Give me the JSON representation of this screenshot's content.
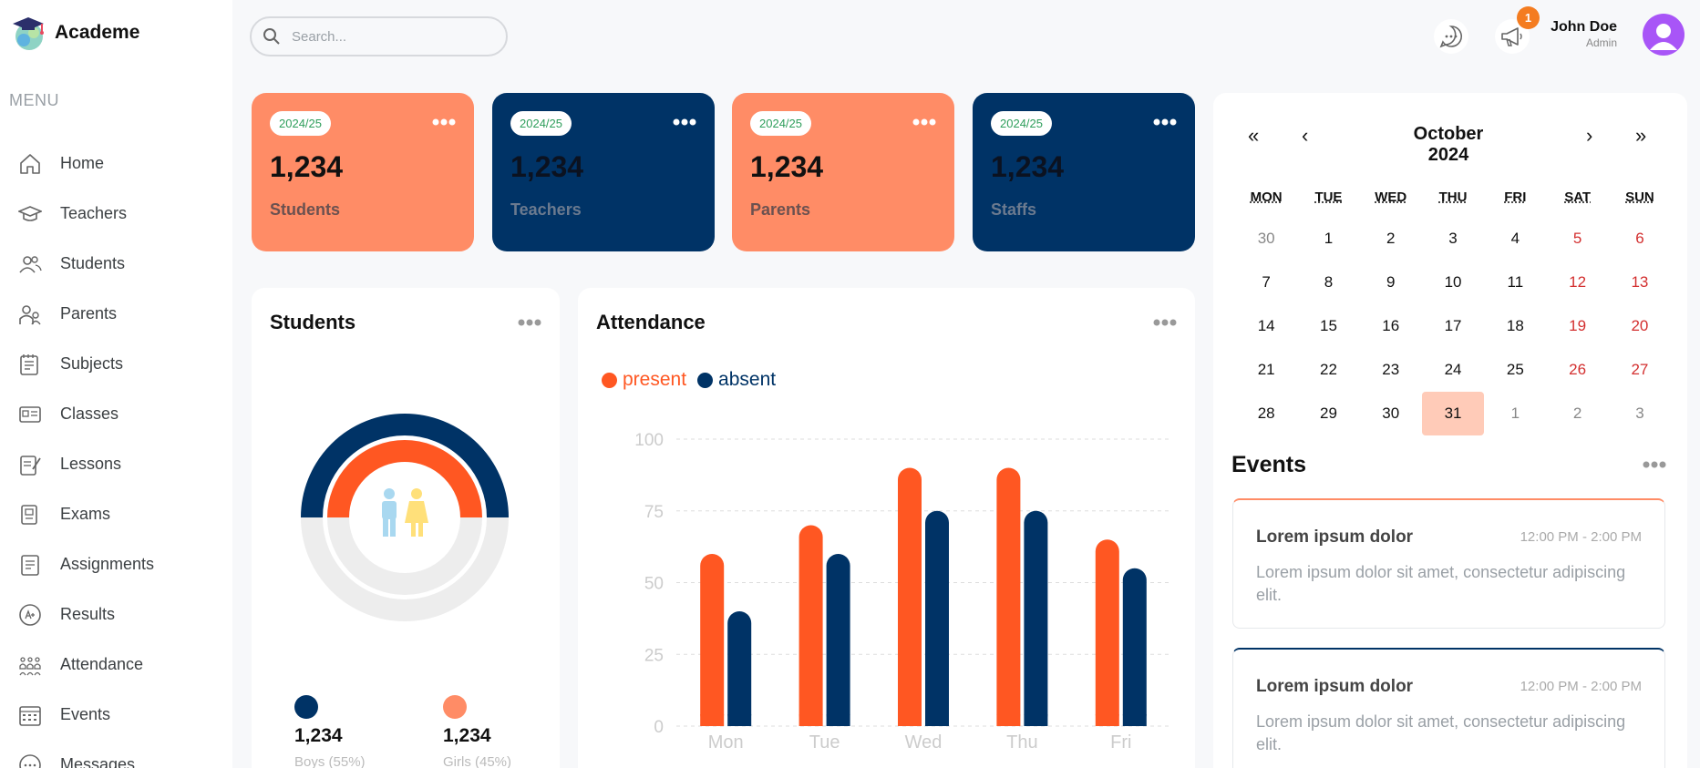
{
  "brand": {
    "name": "Academe"
  },
  "sidebar": {
    "menu_title": "MENU",
    "items": [
      {
        "label": "Home",
        "icon": "home-icon"
      },
      {
        "label": "Teachers",
        "icon": "teacher-icon"
      },
      {
        "label": "Students",
        "icon": "students-icon"
      },
      {
        "label": "Parents",
        "icon": "parents-icon"
      },
      {
        "label": "Subjects",
        "icon": "subjects-icon"
      },
      {
        "label": "Classes",
        "icon": "classes-icon"
      },
      {
        "label": "Lessons",
        "icon": "lessons-icon"
      },
      {
        "label": "Exams",
        "icon": "exams-icon"
      },
      {
        "label": "Assignments",
        "icon": "assignments-icon"
      },
      {
        "label": "Results",
        "icon": "results-icon"
      },
      {
        "label": "Attendance",
        "icon": "attendance-icon"
      },
      {
        "label": "Events",
        "icon": "events-icon"
      },
      {
        "label": "Messages",
        "icon": "messages-icon"
      }
    ]
  },
  "search": {
    "placeholder": "Search..."
  },
  "header": {
    "notification_count": "1",
    "user_name": "John Doe",
    "user_role": "Admin"
  },
  "stats": [
    {
      "year": "2024/25",
      "value": "1,234",
      "label": "Students",
      "color": "#ff8c66"
    },
    {
      "year": "2024/25",
      "value": "1,234",
      "label": "Teachers",
      "color": "#003366"
    },
    {
      "year": "2024/25",
      "value": "1,234",
      "label": "Parents",
      "color": "#ff8c66"
    },
    {
      "year": "2024/25",
      "value": "1,234",
      "label": "Staffs",
      "color": "#003366"
    }
  ],
  "students_panel": {
    "title": "Students",
    "boys": {
      "count": "1,234",
      "label": "Boys (55%)",
      "color": "#003366",
      "share": 0.55
    },
    "girls": {
      "count": "1,234",
      "label": "Girls (45%)",
      "color": "#ff8c66",
      "share": 0.45
    }
  },
  "attendance": {
    "title": "Attendance",
    "legend_present": "present",
    "legend_absent": "absent"
  },
  "chart_data": {
    "type": "bar",
    "categories": [
      "Mon",
      "Tue",
      "Wed",
      "Thu",
      "Fri"
    ],
    "series": [
      {
        "name": "present",
        "color": "#ff5722",
        "values": [
          60,
          70,
          90,
          90,
          65
        ]
      },
      {
        "name": "absent",
        "color": "#003366",
        "values": [
          40,
          60,
          75,
          75,
          55
        ]
      }
    ],
    "ylim": [
      0,
      100
    ],
    "yticks": [
      "0",
      "25",
      "50",
      "75",
      "100"
    ],
    "grid": true,
    "legend": "top-left"
  },
  "calendar": {
    "title": "October 2024",
    "nav_first": "«",
    "nav_prev": "‹",
    "nav_next": "›",
    "nav_last": "»",
    "weekdays": [
      "MON",
      "TUE",
      "WED",
      "THU",
      "FRI",
      "SAT",
      "SUN"
    ],
    "weeks": [
      [
        "30",
        "1",
        "2",
        "3",
        "4",
        "5",
        "6"
      ],
      [
        "7",
        "8",
        "9",
        "10",
        "11",
        "12",
        "13"
      ],
      [
        "14",
        "15",
        "16",
        "17",
        "18",
        "19",
        "20"
      ],
      [
        "21",
        "22",
        "23",
        "24",
        "25",
        "26",
        "27"
      ],
      [
        "28",
        "29",
        "30",
        "31",
        "1",
        "2",
        "3"
      ]
    ],
    "selected": "31"
  },
  "events": {
    "title": "Events",
    "items": [
      {
        "title": "Lorem ipsum dolor",
        "time": "12:00 PM - 2:00 PM",
        "description": "Lorem ipsum dolor sit amet, consectetur adipiscing elit.",
        "accent": "#ff8c66"
      },
      {
        "title": "Lorem ipsum dolor",
        "time": "12:00 PM - 2:00 PM",
        "description": "Lorem ipsum dolor sit amet, consectetur adipiscing elit.",
        "accent": "#003366"
      }
    ]
  }
}
